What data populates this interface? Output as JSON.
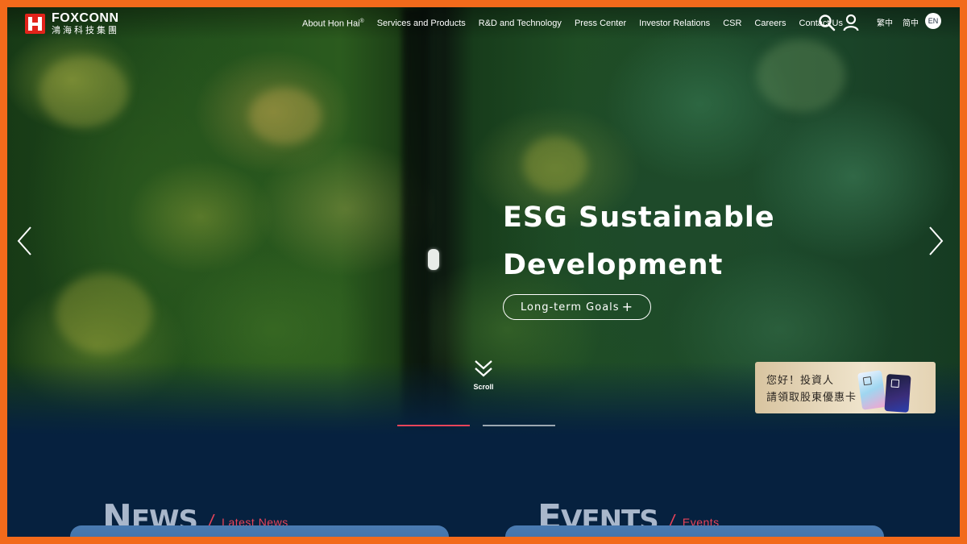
{
  "header": {
    "brand_en": "FOXCONN",
    "brand_zh": "鴻海科技集團",
    "nav": [
      {
        "label": "About Hon Hai",
        "sup": "®"
      },
      {
        "label": "Services and Products"
      },
      {
        "label": "R&D and Technology"
      },
      {
        "label": "Press Center"
      },
      {
        "label": "Investor Relations"
      },
      {
        "label": "CSR"
      },
      {
        "label": "Careers"
      },
      {
        "label": "Contact Us"
      }
    ],
    "icons": [
      "search-icon",
      "user-icon"
    ],
    "languages": {
      "traditional": "繁中",
      "simplified": "简中",
      "english": "EN"
    }
  },
  "hero": {
    "title_line1": "ESG Sustainable",
    "title_line2": "Development",
    "button_label": "Long-term Goals",
    "button_icon": "+",
    "scroll_label": "Scroll",
    "slides_total": 2,
    "active_slide": 1
  },
  "promo": {
    "line1": "您好！投資人",
    "line2": "請領取股東優惠卡"
  },
  "sections": {
    "news": {
      "big_first": "N",
      "big_rest": "EWS",
      "label": "Latest News"
    },
    "events": {
      "big_first": "E",
      "big_rest": "VENTS",
      "label": "Events"
    }
  },
  "colors": {
    "accent": "#e8445a",
    "navy": "#06213f",
    "brand_red": "#e2231a",
    "frame": "#f26a1b"
  }
}
